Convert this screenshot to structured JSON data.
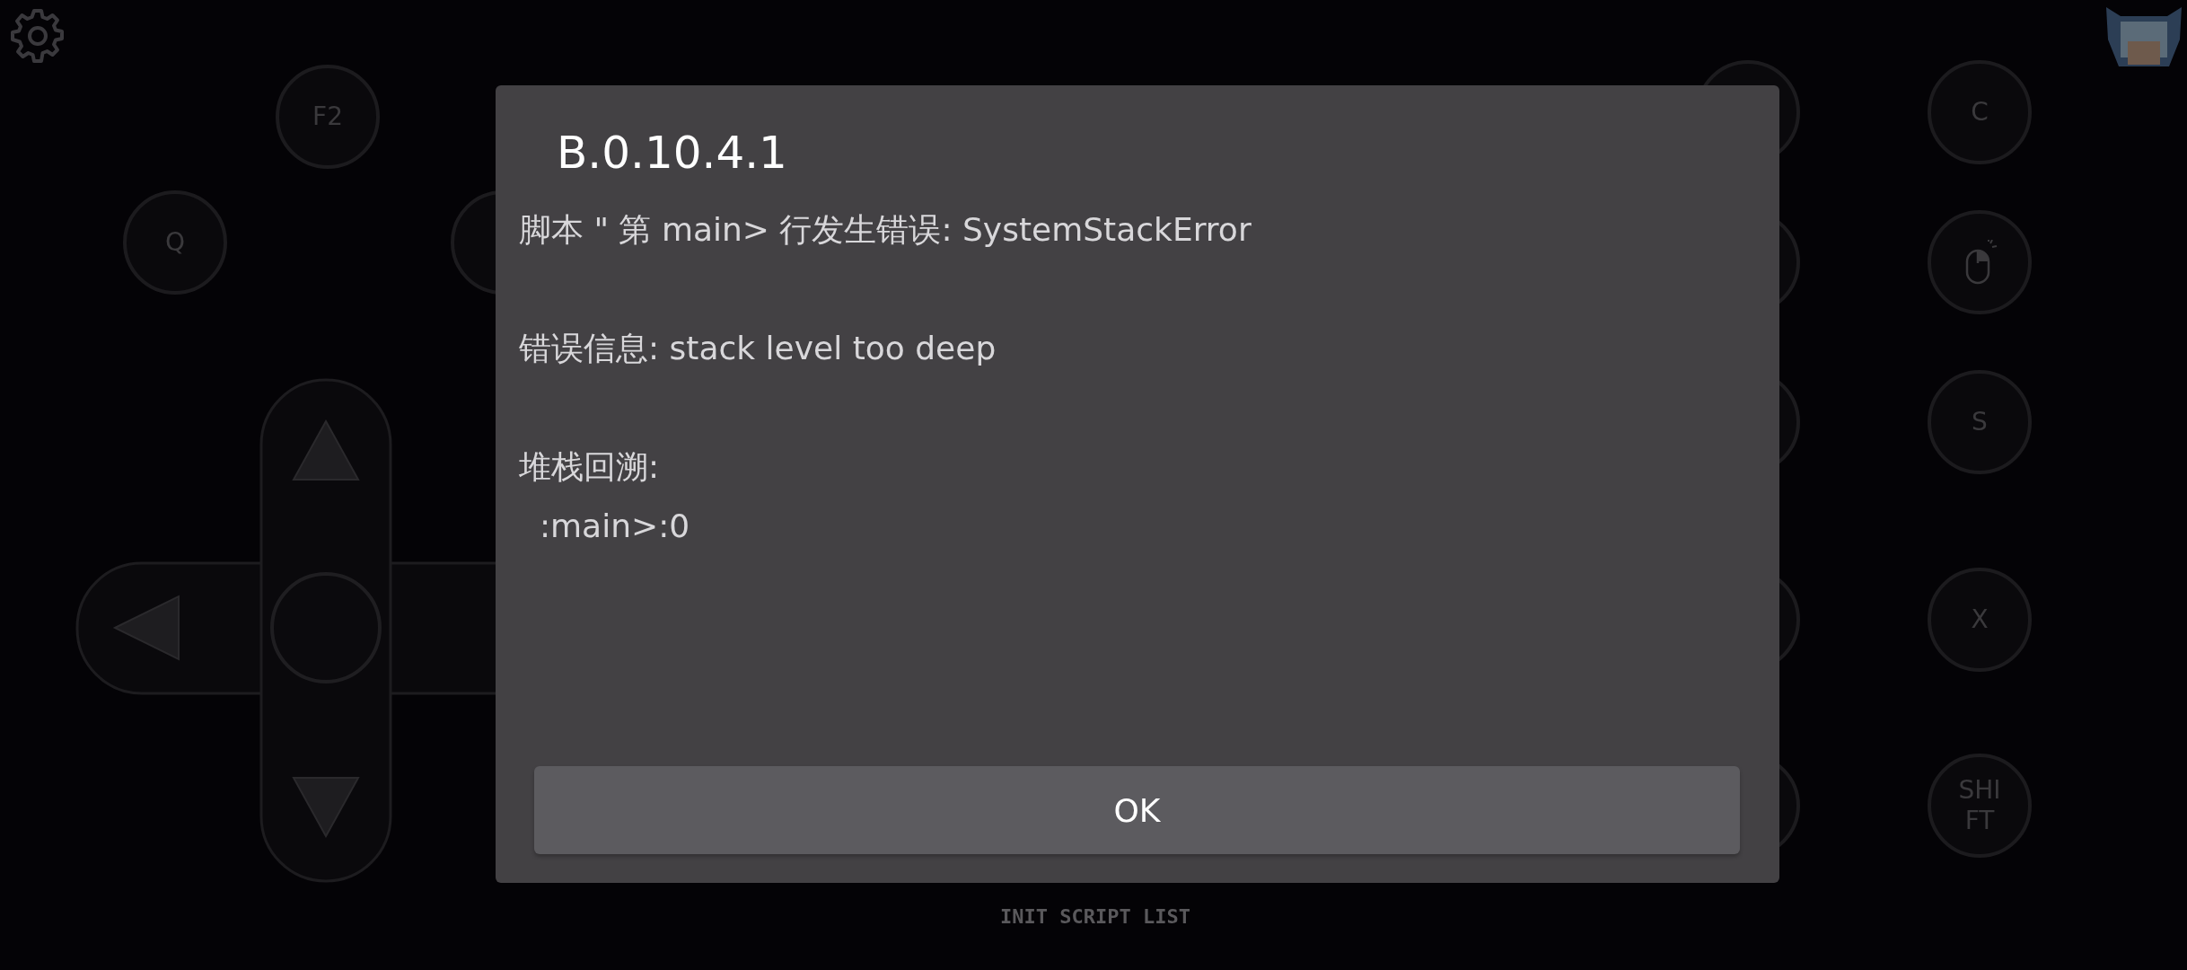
{
  "keys": [
    {
      "kind": "text",
      "label": "F2"
    },
    {
      "kind": "text",
      "label": "Q"
    },
    {
      "kind": "blank"
    },
    {
      "kind": "blank"
    },
    {
      "kind": "blank"
    },
    {
      "kind": "blank"
    },
    {
      "kind": "blank"
    },
    {
      "kind": "blank"
    },
    {
      "kind": "text",
      "label": "C"
    },
    {
      "kind": "mouse"
    },
    {
      "kind": "text",
      "label": "S"
    },
    {
      "kind": "text",
      "label": "X"
    },
    {
      "kind": "text",
      "label": "SHI\nFT"
    }
  ],
  "dialog": {
    "title": "B.0.10.4.1",
    "paragraphs": [
      [
        "脚本 \" 第 main> 行发生错误: SystemStackError"
      ],
      [
        "错误信息: stack level too deep"
      ],
      [
        "堆栈回溯:",
        "  :main>:0"
      ]
    ],
    "button": "OK"
  },
  "footer": "INIT SCRIPT LIST"
}
